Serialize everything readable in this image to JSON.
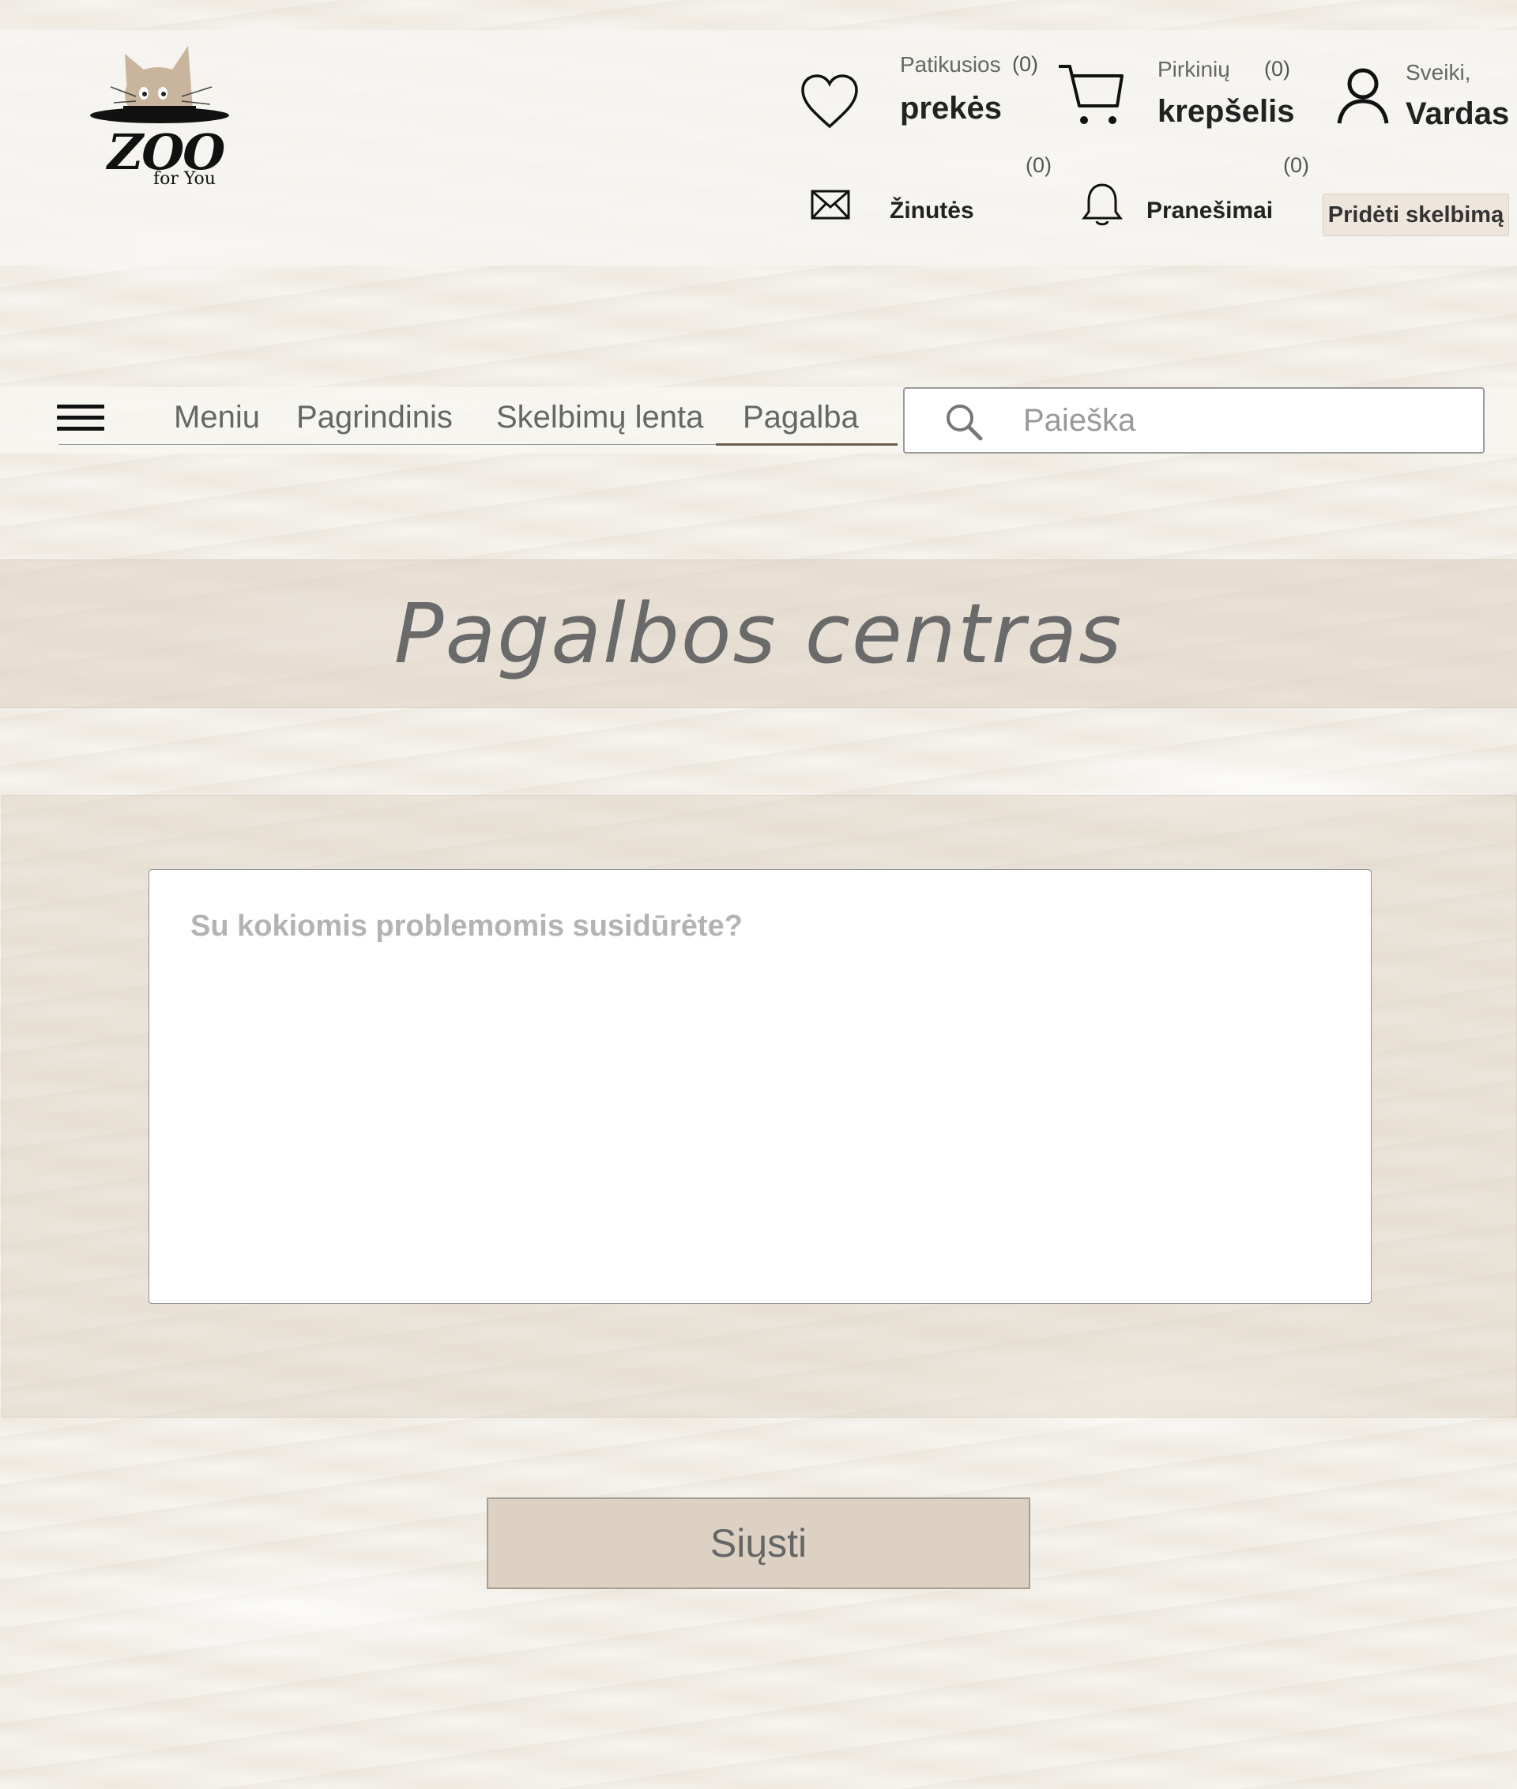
{
  "brand": {
    "logo_word": "ZOO",
    "logo_tag": "for You"
  },
  "header": {
    "favorites": {
      "icon": "heart-icon",
      "small": "Patikusios",
      "big": "prekės",
      "count": "(0)"
    },
    "cart": {
      "icon": "cart-icon",
      "small": "Pirkinių",
      "big": "krepšelis",
      "count": "(0)"
    },
    "user": {
      "icon": "user-icon",
      "greeting": "Sveiki,",
      "name": "Vardas"
    },
    "messages": {
      "icon": "envelope-icon",
      "label": "Žinutės",
      "count": "(0)"
    },
    "notifications": {
      "icon": "bell-icon",
      "label": "Pranešimai",
      "count": "(0)"
    },
    "add_ad_label": "Pridėti skelbimą"
  },
  "nav": {
    "items": [
      "Meniu",
      "Pagrindinis",
      "Skelbimų lenta",
      "Pagalba"
    ],
    "active": "Pagalba"
  },
  "search": {
    "placeholder": "Paieška",
    "value": ""
  },
  "page": {
    "title": "Pagalbos centras",
    "textarea_placeholder": "Su kokiomis problemomis susidūrėte?",
    "send_label": "Siųsti"
  },
  "colors": {
    "accent_beige": "#ddd1c4",
    "active_underline": "#6b5d50",
    "text_gray": "#666666"
  }
}
